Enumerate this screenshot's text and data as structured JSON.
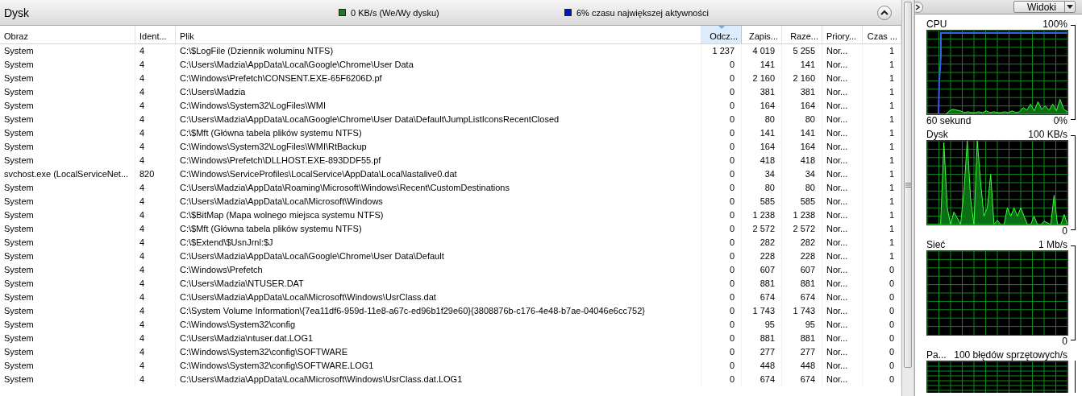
{
  "disk_panel": {
    "title": "Dysk",
    "legend": [
      {
        "text": "0 KB/s (We/Wy dysku)",
        "color": "#1f7a1f"
      },
      {
        "text": "6% czasu największej aktywności",
        "color": "#0018c8"
      }
    ]
  },
  "table": {
    "columns": [
      {
        "label": "Obraz",
        "kind": "text",
        "sorted": false
      },
      {
        "label": "Ident...",
        "kind": "text",
        "sorted": false
      },
      {
        "label": "Plik",
        "kind": "text",
        "sorted": false
      },
      {
        "label": "Odcz...",
        "kind": "number",
        "sorted": true
      },
      {
        "label": "Zapis...",
        "kind": "number",
        "sorted": false
      },
      {
        "label": "Raze...",
        "kind": "number",
        "sorted": false
      },
      {
        "label": "Priory...",
        "kind": "text",
        "sorted": false
      },
      {
        "label": "Czas ...",
        "kind": "number",
        "sorted": false
      }
    ],
    "rows": [
      [
        "System",
        "4",
        "C:\\$LogFile (Dziennik woluminu NTFS)",
        "1 237",
        "4 019",
        "5 255",
        "Nor...",
        "1"
      ],
      [
        "System",
        "4",
        "C:\\Users\\Madzia\\AppData\\Local\\Google\\Chrome\\User Data",
        "0",
        "141",
        "141",
        "Nor...",
        "1"
      ],
      [
        "System",
        "4",
        "C:\\Windows\\Prefetch\\CONSENT.EXE-65F6206D.pf",
        "0",
        "2 160",
        "2 160",
        "Nor...",
        "1"
      ],
      [
        "System",
        "4",
        "C:\\Users\\Madzia",
        "0",
        "381",
        "381",
        "Nor...",
        "1"
      ],
      [
        "System",
        "4",
        "C:\\Windows\\System32\\LogFiles\\WMI",
        "0",
        "164",
        "164",
        "Nor...",
        "1"
      ],
      [
        "System",
        "4",
        "C:\\Users\\Madzia\\AppData\\Local\\Google\\Chrome\\User Data\\Default\\JumpListIconsRecentClosed",
        "0",
        "80",
        "80",
        "Nor...",
        "1"
      ],
      [
        "System",
        "4",
        "C:\\$Mft (Główna tabela plików systemu NTFS)",
        "0",
        "141",
        "141",
        "Nor...",
        "1"
      ],
      [
        "System",
        "4",
        "C:\\Windows\\System32\\LogFiles\\WMI\\RtBackup",
        "0",
        "164",
        "164",
        "Nor...",
        "1"
      ],
      [
        "System",
        "4",
        "C:\\Windows\\Prefetch\\DLLHOST.EXE-893DDF55.pf",
        "0",
        "418",
        "418",
        "Nor...",
        "1"
      ],
      [
        "svchost.exe (LocalServiceNet...",
        "820",
        "C:\\Windows\\ServiceProfiles\\LocalService\\AppData\\Local\\lastalive0.dat",
        "0",
        "34",
        "34",
        "Nor...",
        "1"
      ],
      [
        "System",
        "4",
        "C:\\Users\\Madzia\\AppData\\Roaming\\Microsoft\\Windows\\Recent\\CustomDestinations",
        "0",
        "80",
        "80",
        "Nor...",
        "1"
      ],
      [
        "System",
        "4",
        "C:\\Users\\Madzia\\AppData\\Local\\Microsoft\\Windows",
        "0",
        "585",
        "585",
        "Nor...",
        "1"
      ],
      [
        "System",
        "4",
        "C:\\$BitMap (Mapa wolnego miejsca systemu NTFS)",
        "0",
        "1 238",
        "1 238",
        "Nor...",
        "1"
      ],
      [
        "System",
        "4",
        "C:\\$Mft (Główna tabela plików systemu NTFS)",
        "0",
        "2 572",
        "2 572",
        "Nor...",
        "1"
      ],
      [
        "System",
        "4",
        "C:\\$Extend\\$UsnJrnl:$J",
        "0",
        "282",
        "282",
        "Nor...",
        "1"
      ],
      [
        "System",
        "4",
        "C:\\Users\\Madzia\\AppData\\Local\\Google\\Chrome\\User Data\\Default",
        "0",
        "228",
        "228",
        "Nor...",
        "1"
      ],
      [
        "System",
        "4",
        "C:\\Windows\\Prefetch",
        "0",
        "607",
        "607",
        "Nor...",
        "0"
      ],
      [
        "System",
        "4",
        "C:\\Users\\Madzia\\NTUSER.DAT",
        "0",
        "881",
        "881",
        "Nor...",
        "0"
      ],
      [
        "System",
        "4",
        "C:\\Users\\Madzia\\AppData\\Local\\Microsoft\\Windows\\UsrClass.dat",
        "0",
        "674",
        "674",
        "Nor...",
        "0"
      ],
      [
        "System",
        "4",
        "C:\\System Volume Information\\{7ea11df6-959d-11e8-a67c-ed96b1f29e60}{3808876b-c176-4e48-b7ae-04046e6cc752}",
        "0",
        "1 743",
        "1 743",
        "Nor...",
        "0"
      ],
      [
        "System",
        "4",
        "C:\\Windows\\System32\\config",
        "0",
        "95",
        "95",
        "Nor...",
        "0"
      ],
      [
        "System",
        "4",
        "C:\\Users\\Madzia\\ntuser.dat.LOG1",
        "0",
        "881",
        "881",
        "Nor...",
        "0"
      ],
      [
        "System",
        "4",
        "C:\\Windows\\System32\\config\\SOFTWARE",
        "0",
        "277",
        "277",
        "Nor...",
        "0"
      ],
      [
        "System",
        "4",
        "C:\\Windows\\System32\\config\\SOFTWARE.LOG1",
        "0",
        "448",
        "448",
        "Nor...",
        "0"
      ],
      [
        "System",
        "4",
        "C:\\Users\\Madzia\\AppData\\Local\\Microsoft\\Windows\\UsrClass.dat.LOG1",
        "0",
        "674",
        "674",
        "Nor...",
        "0"
      ]
    ]
  },
  "side_panel": {
    "views_button": "Widoki",
    "graphs": [
      {
        "kind": "cpu",
        "title": "CPU",
        "max": "100%",
        "time": "60 sekund",
        "min": "0%"
      },
      {
        "kind": "disk",
        "title": "Dysk",
        "max": "100 KB/s",
        "min": "0"
      },
      {
        "kind": "network",
        "title": "Sieć",
        "max": "1 Mb/s",
        "min": "0"
      },
      {
        "kind": "memory",
        "title": "Pa...",
        "max": "100 błędów sprzętowych/s"
      }
    ]
  }
}
